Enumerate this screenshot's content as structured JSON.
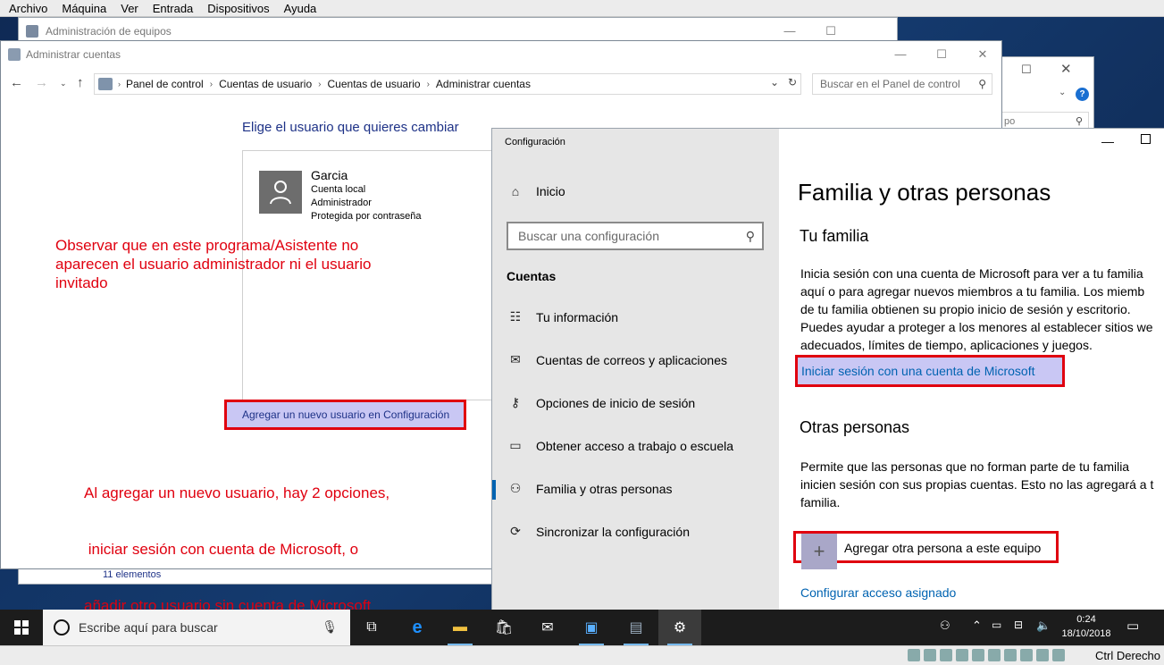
{
  "vbox": {
    "menu": [
      "Archivo",
      "Máquina",
      "Ver",
      "Entrada",
      "Dispositivos",
      "Ayuda"
    ],
    "host_key": "Ctrl Derecho"
  },
  "win_equipos": {
    "title": "Administración de equipos",
    "status_items": "11 elementos"
  },
  "win_right": {
    "search_fragment": "po"
  },
  "win_cuentas": {
    "title": "Administrar cuentas",
    "breadcrumb": [
      "Panel de control",
      "Cuentas de usuario",
      "Cuentas de usuario",
      "Administrar cuentas"
    ],
    "search_placeholder": "Buscar en el Panel de control",
    "heading": "Elige el usuario que quieres cambiar",
    "user": {
      "name": "Garcia",
      "lines": [
        "Cuenta local",
        "Administrador",
        "Protegida por contraseña"
      ]
    },
    "add_user_link": "Agregar un nuevo usuario en Configuración",
    "annotation_1": [
      "Observar que en este programa/Asistente no",
      "aparecen el usuario administrador ni el usuario",
      "invitado"
    ],
    "annotation_2": [
      "Al agregar un nuevo usuario, hay 2 opciones,",
      " iniciar sesión con cuenta de Microsoft, o",
      "añadir otro usuario sin cuenta de Microsoft"
    ]
  },
  "config": {
    "window_title": "Configuración",
    "home": "Inicio",
    "search_placeholder": "Buscar una configuración",
    "section": "Cuentas",
    "nav": [
      {
        "label": "Tu información",
        "icon": "person-card-icon"
      },
      {
        "label": "Cuentas de correos y aplicaciones",
        "icon": "mail-icon"
      },
      {
        "label": "Opciones de inicio de sesión",
        "icon": "key-icon"
      },
      {
        "label": "Obtener acceso a trabajo o escuela",
        "icon": "briefcase-icon"
      },
      {
        "label": "Familia y otras personas",
        "icon": "person-add-icon"
      },
      {
        "label": "Sincronizar la configuración",
        "icon": "sync-icon"
      }
    ],
    "active_nav": "Familia y otras personas",
    "page_title": "Familia y otras personas",
    "family_heading": "Tu familia",
    "family_text": [
      "Inicia sesión con una cuenta de Microsoft para ver a tu familia",
      "aquí o para agregar nuevos miembros a tu familia. Los miemb",
      "de tu familia obtienen su propio inicio de sesión y escritorio.",
      "Puedes ayudar a proteger a los menores al establecer sitios we",
      "adecuados, límites de tiempo, aplicaciones y juegos."
    ],
    "ms_signin_link": "Iniciar sesión con una cuenta de Microsoft",
    "others_heading": "Otras personas",
    "others_text": [
      "Permite que las personas que no forman parte de tu familia",
      "inicien sesión con sus propias cuentas. Esto no las agregará a t",
      "familia."
    ],
    "add_person": "Agregar otra persona a este equipo",
    "assigned_access": "Configurar acceso asignado"
  },
  "taskbar": {
    "search_placeholder": "Escribe aquí para buscar",
    "time": "0:24",
    "date": "18/10/2018"
  },
  "colors": {
    "annotation_red": "#e0000f",
    "highlight": "#c9c7f4",
    "link_blue": "#0063b1",
    "cp_heading_blue": "#1e3287"
  }
}
